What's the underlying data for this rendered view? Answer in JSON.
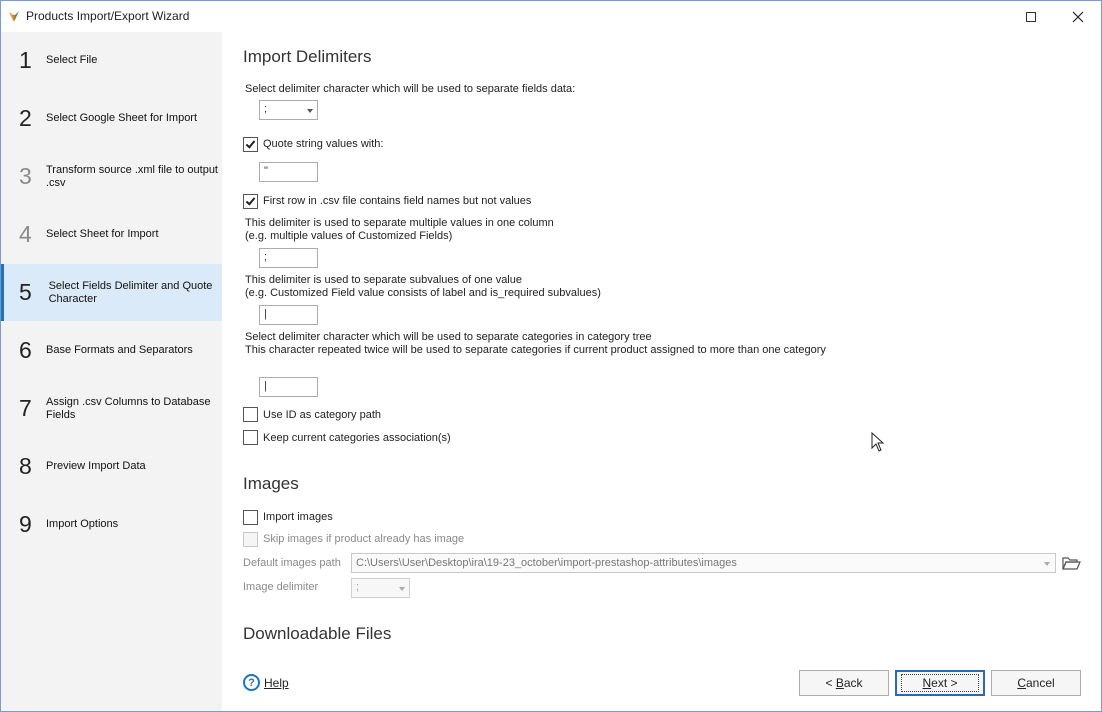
{
  "window": {
    "title": "Products Import/Export Wizard"
  },
  "steps": [
    {
      "num": "1",
      "label": "Select File",
      "state": "normal"
    },
    {
      "num": "2",
      "label": "Select Google Sheet for Import",
      "state": "normal"
    },
    {
      "num": "3",
      "label": "Transform source .xml file to output .csv",
      "state": "dim"
    },
    {
      "num": "4",
      "label": "Select Sheet for Import",
      "state": "dim"
    },
    {
      "num": "5",
      "label": "Select Fields Delimiter and Quote Character",
      "state": "active"
    },
    {
      "num": "6",
      "label": "Base Formats and Separators",
      "state": "normal"
    },
    {
      "num": "7",
      "label": "Assign .csv Columns to Database Fields",
      "state": "normal"
    },
    {
      "num": "8",
      "label": "Preview Import Data",
      "state": "normal"
    },
    {
      "num": "9",
      "label": "Import Options",
      "state": "normal"
    }
  ],
  "import_delimiters": {
    "heading": "Import Delimiters",
    "field_delim_label": "Select delimiter character which will be used to separate fields data:",
    "field_delim_value": ";",
    "quote_checked": true,
    "quote_label": "Quote string values with:",
    "quote_value": "\"",
    "first_row_checked": true,
    "first_row_label": "First row in .csv file contains field names but not values",
    "multi_label_1": "This delimiter is used to separate multiple values in one column",
    "multi_label_2": "(e.g. multiple values of Customized Fields)",
    "multi_value": ";",
    "sub_label_1": "This delimiter is used to separate subvalues of one value",
    "sub_label_2": "(e.g. Customized Field value consists of label and is_required subvalues)",
    "sub_value": "|",
    "cat_label_1": "Select delimiter character which will be used to separate categories in category tree",
    "cat_label_2": "This character repeated twice will be used to separate categories if current product assigned to more than one category",
    "cat_value": "|",
    "use_id_checked": false,
    "use_id_label": "Use ID as category path",
    "keep_cat_checked": false,
    "keep_cat_label": "Keep current categories association(s)"
  },
  "images": {
    "heading": "Images",
    "import_checked": false,
    "import_label": "Import images",
    "skip_checked": false,
    "skip_label": "Skip images if product already has image",
    "path_label": "Default images path",
    "path_value": "C:\\Users\\User\\Desktop\\ira\\19-23_october\\import-prestashop-attributes\\images",
    "delim_label": "Image delimiter",
    "delim_value": ";"
  },
  "downloadable": {
    "heading": "Downloadable Files"
  },
  "footer": {
    "help_label": "Help",
    "back_prefix": "< ",
    "back_key": "B",
    "back_rest": "ack",
    "next_key": "N",
    "next_rest": "ext >",
    "cancel_key": "C",
    "cancel_rest": "ancel"
  },
  "colors": {
    "accent": "#1e73be",
    "active_step_bg": "#dbeaf8",
    "sidebar_bg": "#f3f3f3"
  }
}
